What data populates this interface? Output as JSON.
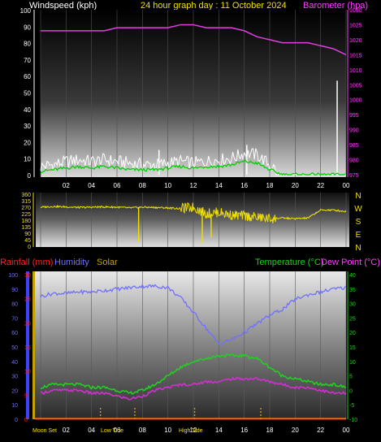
{
  "header": {
    "left_label": "Windspeed (kph)",
    "center_title": "24 hour graph day : 11 October 2024",
    "right_label": "Barometer (hpa)"
  },
  "colors": {
    "wind": "#ffffff",
    "wind_avg": "#00d000",
    "barometer": "#e040e0",
    "direction": "#f0e000",
    "humidity": "#7070ff",
    "temperature": "#20d020",
    "dewpoint": "#d030d0",
    "rainfall": "#ff2020",
    "solar": "#c8a000",
    "axis_left": "#ffffff",
    "axis_right": "#ff40ff"
  },
  "x_ticks": [
    "02",
    "04",
    "06",
    "08",
    "10",
    "12",
    "14",
    "16",
    "18",
    "20",
    "22",
    "00"
  ],
  "panel3_labels": {
    "rainfall": "Rainfall (mm)",
    "humidity": "Humidity",
    "solar": "Solar",
    "temperature": "Temperature (°C)",
    "dewpoint": "Dew Point (°C)"
  },
  "events": {
    "moon_set": "Moon Set",
    "low_tide": "Low Tide",
    "high_tide": "High Tide"
  },
  "direction_letters": [
    "N",
    "W",
    "S",
    "E",
    "N"
  ],
  "chart_data": [
    {
      "type": "line",
      "title": "24 hour graph day : 11 October 2024",
      "x_hours": [
        0,
        1,
        2,
        3,
        4,
        5,
        6,
        7,
        8,
        9,
        10,
        11,
        12,
        13,
        14,
        15,
        16,
        17,
        18,
        19,
        20,
        21,
        22,
        23,
        24
      ],
      "series": [
        {
          "name": "Windspeed (kph)",
          "axis": "left",
          "values": [
            5,
            6,
            8,
            9,
            8,
            9,
            8,
            7,
            6,
            6,
            7,
            8,
            7,
            8,
            9,
            10,
            13,
            12,
            6,
            0,
            0,
            0,
            0,
            0,
            0
          ]
        },
        {
          "name": "Barometer (hpa)",
          "axis": "right",
          "values": [
            1023,
            1023,
            1023,
            1023,
            1023,
            1023,
            1024,
            1024,
            1024,
            1024,
            1024,
            1025,
            1025,
            1024,
            1024,
            1024,
            1023,
            1021,
            1020,
            1019,
            1019,
            1019,
            1018,
            1017,
            1015
          ]
        }
      ],
      "avg_wind": [
        2,
        3,
        4,
        5,
        4,
        5,
        4,
        3,
        3,
        3,
        4,
        5,
        4,
        5,
        5,
        6,
        8,
        7,
        3,
        0,
        0,
        0,
        0,
        0,
        0
      ],
      "gust_spikes": [
        {
          "hour": 9.3,
          "value": 15
        },
        {
          "hour": 16.2,
          "value": 18
        },
        {
          "hour": 23.3,
          "value": 57
        }
      ],
      "ylim_left": [
        0,
        100
      ],
      "ylim_right": [
        975,
        1030
      ],
      "yticks_left": [
        0,
        10,
        20,
        30,
        40,
        50,
        60,
        70,
        80,
        90,
        100
      ],
      "yticks_right": [
        975,
        980,
        985,
        990,
        995,
        1000,
        1005,
        1010,
        1015,
        1020,
        1025,
        1030
      ]
    },
    {
      "type": "line",
      "title": "",
      "x_hours": [
        0,
        1,
        2,
        3,
        4,
        5,
        6,
        7,
        8,
        9,
        10,
        11,
        12,
        13,
        14,
        15,
        16,
        17,
        18,
        19,
        20,
        21,
        22,
        23,
        24
      ],
      "series": [
        {
          "name": "",
          "axis": "left",
          "values": [
            270,
            275,
            272,
            268,
            270,
            272,
            270,
            265,
            270,
            268,
            265,
            260,
            270,
            225,
            235,
            215,
            210,
            200,
            190,
            195,
            190,
            195,
            250,
            250,
            240
          ]
        }
      ],
      "dips": [
        {
          "hour": 7.7,
          "value": 30
        },
        {
          "hour": 12.7,
          "value": 20
        },
        {
          "hour": 13.4,
          "value": 60
        }
      ],
      "ylim_left": [
        0,
        360
      ],
      "yticks_left": [
        0,
        45,
        90,
        135,
        180,
        225,
        270,
        315,
        360
      ]
    },
    {
      "type": "line",
      "title": "",
      "x_hours": [
        0,
        1,
        2,
        3,
        4,
        5,
        6,
        7,
        8,
        9,
        10,
        11,
        12,
        13,
        14,
        15,
        16,
        17,
        18,
        19,
        20,
        21,
        22,
        23,
        24
      ],
      "series": [
        {
          "name": "Humidity",
          "axis": "left",
          "values": [
            85,
            87,
            87,
            88,
            88,
            89,
            90,
            91,
            92,
            92,
            91,
            84,
            74,
            63,
            52,
            55,
            60,
            66,
            72,
            76,
            83,
            86,
            88,
            90,
            91
          ]
        },
        {
          "name": "Temperature (°C)",
          "axis": "right",
          "values": [
            1,
            2,
            2,
            2,
            1,
            1,
            0,
            -1,
            0,
            2,
            5,
            8,
            10,
            11,
            12,
            12,
            12,
            11,
            8,
            5,
            4,
            3,
            2,
            2,
            1
          ]
        },
        {
          "name": "Dew Point (°C)",
          "axis": "right",
          "values": [
            -1,
            0,
            0,
            0,
            -1,
            -1,
            -2,
            -3,
            -2,
            0,
            1,
            2,
            2,
            3,
            3,
            4,
            4,
            4,
            3,
            2,
            1,
            1,
            0,
            -1,
            -1
          ]
        },
        {
          "name": "Rainfall (mm)",
          "axis": "rain",
          "values": [
            0,
            0,
            0,
            0,
            0,
            0,
            0,
            0,
            0,
            0,
            0,
            0,
            0,
            0,
            0,
            0,
            0,
            0,
            0,
            0,
            0,
            0,
            0,
            0,
            0
          ]
        }
      ],
      "ylim_left": [
        0,
        100
      ],
      "ylim_rain": [
        0,
        30
      ],
      "ylim_right": [
        -10,
        40
      ],
      "yticks_left": [
        0,
        10,
        20,
        30,
        40,
        50,
        60,
        70,
        80,
        90,
        100
      ],
      "yticks_rain": [
        0,
        5,
        10,
        15,
        20,
        25,
        30
      ],
      "yticks_right": [
        -10,
        -5,
        0,
        5,
        10,
        15,
        20,
        25,
        30,
        35,
        40
      ],
      "solar_marks": [
        {
          "hour": 4.7
        },
        {
          "hour": 7.4
        },
        {
          "hour": 12.1
        },
        {
          "hour": 17.3
        }
      ]
    }
  ]
}
